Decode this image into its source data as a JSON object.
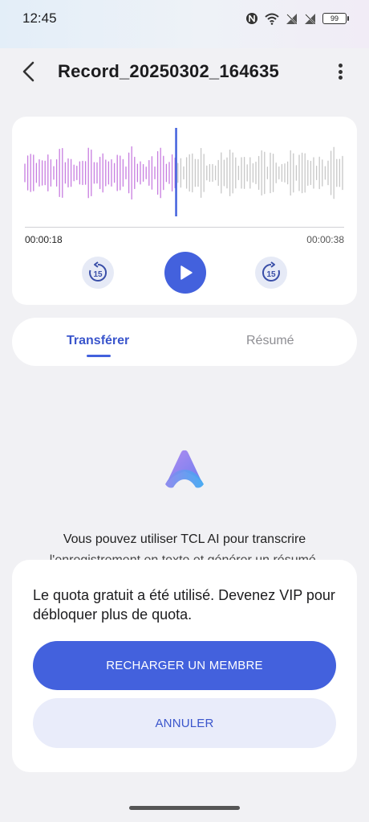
{
  "status_bar": {
    "time": "12:45",
    "battery": "99"
  },
  "header": {
    "title": "Record_20250302_164635"
  },
  "player": {
    "elapsed": "00:00:18",
    "total": "00:00:38",
    "progress": 0.474,
    "skip_back_label": "15",
    "skip_forward_label": "15",
    "played_color": "#c77de0",
    "unplayed_color": "#c7c7c7",
    "playhead_color": "#4361dd"
  },
  "tabs": [
    {
      "label": "Transférer",
      "active": true
    },
    {
      "label": "Résumé",
      "active": false
    }
  ],
  "ai_promo": {
    "line1": "Vous pouvez utiliser TCL AI pour transcrire",
    "line2": "l'enregistrement en texte et générer un résumé."
  },
  "quota_sheet": {
    "message": "Le quota gratuit a été utilisé. Devenez VIP pour débloquer plus de quota.",
    "primary_button": "RECHARGER UN MEMBRE",
    "secondary_button": "ANNULER"
  },
  "colors": {
    "accent": "#4361dd",
    "background": "#f1f1f4"
  }
}
